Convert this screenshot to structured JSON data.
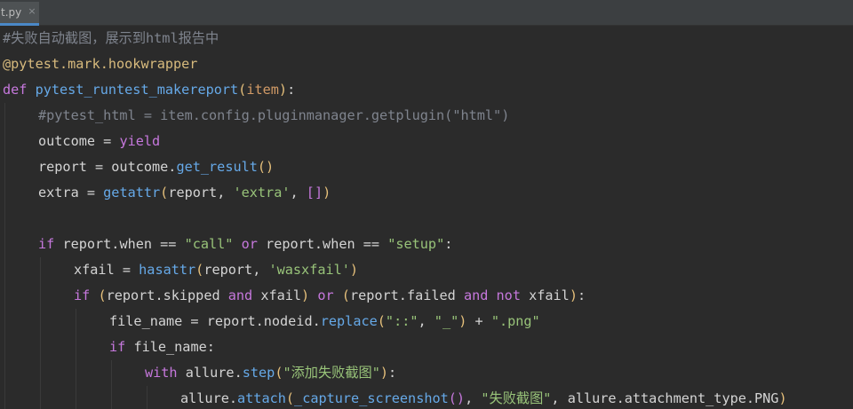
{
  "tab": {
    "label": "t.py",
    "close_glyph": "×"
  },
  "code_lines": [
    {
      "indent": 0,
      "tokens": [
        {
          "t": "#失败自动截图，展示到html报告中",
          "c": "comment"
        }
      ]
    },
    {
      "indent": 0,
      "tokens": [
        {
          "t": "@pytest.mark.hookwrapper",
          "c": "decorator"
        }
      ]
    },
    {
      "indent": 0,
      "tokens": [
        {
          "t": "def ",
          "c": "kw2"
        },
        {
          "t": "pytest_runtest_makereport",
          "c": "func"
        },
        {
          "t": "(",
          "c": "bracket-yellow"
        },
        {
          "t": "item",
          "c": "param"
        },
        {
          "t": ")",
          "c": "bracket-yellow"
        },
        {
          "t": ":",
          "c": "op"
        }
      ]
    },
    {
      "indent": 1,
      "tokens": [
        {
          "t": "#pytest_html = item.config.pluginmanager.getplugin(\"html\")",
          "c": "comment"
        }
      ]
    },
    {
      "indent": 1,
      "tokens": [
        {
          "t": "outcome = ",
          "c": "ident"
        },
        {
          "t": "yield",
          "c": "kw2"
        }
      ]
    },
    {
      "indent": 1,
      "tokens": [
        {
          "t": "report = outcome.",
          "c": "ident"
        },
        {
          "t": "get_result",
          "c": "func"
        },
        {
          "t": "()",
          "c": "bracket-yellow"
        }
      ]
    },
    {
      "indent": 1,
      "tokens": [
        {
          "t": "extra = ",
          "c": "ident"
        },
        {
          "t": "getattr",
          "c": "func"
        },
        {
          "t": "(",
          "c": "bracket-yellow"
        },
        {
          "t": "report, ",
          "c": "ident"
        },
        {
          "t": "'extra'",
          "c": "string"
        },
        {
          "t": ", ",
          "c": "ident"
        },
        {
          "t": "[]",
          "c": "bracket-purple"
        },
        {
          "t": ")",
          "c": "bracket-yellow"
        }
      ]
    },
    {
      "indent": 0,
      "tokens": []
    },
    {
      "indent": 1,
      "tokens": [
        {
          "t": "if ",
          "c": "kw2"
        },
        {
          "t": "report.when == ",
          "c": "ident"
        },
        {
          "t": "\"call\"",
          "c": "string"
        },
        {
          "t": " or ",
          "c": "kw2"
        },
        {
          "t": "report.when == ",
          "c": "ident"
        },
        {
          "t": "\"setup\"",
          "c": "string"
        },
        {
          "t": ":",
          "c": "ident"
        }
      ]
    },
    {
      "indent": 2,
      "tokens": [
        {
          "t": "xfail = ",
          "c": "ident"
        },
        {
          "t": "hasattr",
          "c": "func"
        },
        {
          "t": "(",
          "c": "bracket-yellow"
        },
        {
          "t": "report, ",
          "c": "ident"
        },
        {
          "t": "'wasxfail'",
          "c": "string"
        },
        {
          "t": ")",
          "c": "bracket-yellow"
        }
      ]
    },
    {
      "indent": 2,
      "tokens": [
        {
          "t": "if ",
          "c": "kw2"
        },
        {
          "t": "(",
          "c": "bracket-yellow"
        },
        {
          "t": "report.skipped ",
          "c": "ident"
        },
        {
          "t": "and ",
          "c": "kw2"
        },
        {
          "t": "xfail",
          "c": "ident"
        },
        {
          "t": ")",
          "c": "bracket-yellow"
        },
        {
          "t": " or ",
          "c": "kw2"
        },
        {
          "t": "(",
          "c": "bracket-yellow"
        },
        {
          "t": "report.failed ",
          "c": "ident"
        },
        {
          "t": "and not ",
          "c": "kw2"
        },
        {
          "t": "xfail",
          "c": "ident"
        },
        {
          "t": ")",
          "c": "bracket-yellow"
        },
        {
          "t": ":",
          "c": "ident"
        }
      ]
    },
    {
      "indent": 3,
      "tokens": [
        {
          "t": "file_name = report.nodeid.",
          "c": "ident"
        },
        {
          "t": "replace",
          "c": "func"
        },
        {
          "t": "(",
          "c": "bracket-yellow"
        },
        {
          "t": "\"::\"",
          "c": "string"
        },
        {
          "t": ", ",
          "c": "ident"
        },
        {
          "t": "\"_\"",
          "c": "string"
        },
        {
          "t": ")",
          "c": "bracket-yellow"
        },
        {
          "t": " + ",
          "c": "ident"
        },
        {
          "t": "\".png\"",
          "c": "string"
        }
      ]
    },
    {
      "indent": 3,
      "tokens": [
        {
          "t": "if ",
          "c": "kw2"
        },
        {
          "t": "file_name:",
          "c": "ident"
        }
      ]
    },
    {
      "indent": 4,
      "tokens": [
        {
          "t": "with ",
          "c": "kw2"
        },
        {
          "t": "allure.",
          "c": "ident"
        },
        {
          "t": "step",
          "c": "func"
        },
        {
          "t": "(",
          "c": "bracket-yellow"
        },
        {
          "t": "\"添加失败截图\"",
          "c": "string"
        },
        {
          "t": ")",
          "c": "bracket-yellow"
        },
        {
          "t": ":",
          "c": "ident"
        }
      ]
    },
    {
      "indent": 5,
      "tokens": [
        {
          "t": "allure.",
          "c": "ident"
        },
        {
          "t": "attach",
          "c": "func"
        },
        {
          "t": "(",
          "c": "bracket-yellow"
        },
        {
          "t": "_capture_screenshot",
          "c": "func"
        },
        {
          "t": "()",
          "c": "bracket-purple"
        },
        {
          "t": ", ",
          "c": "ident"
        },
        {
          "t": "\"失败截图\"",
          "c": "string"
        },
        {
          "t": ", allure.attachment_type.PNG",
          "c": "ident"
        },
        {
          "t": ")",
          "c": "bracket-yellow"
        }
      ]
    }
  ],
  "colors": {
    "background": "#2b2b2b",
    "tab_accent": "#4a88c7"
  }
}
